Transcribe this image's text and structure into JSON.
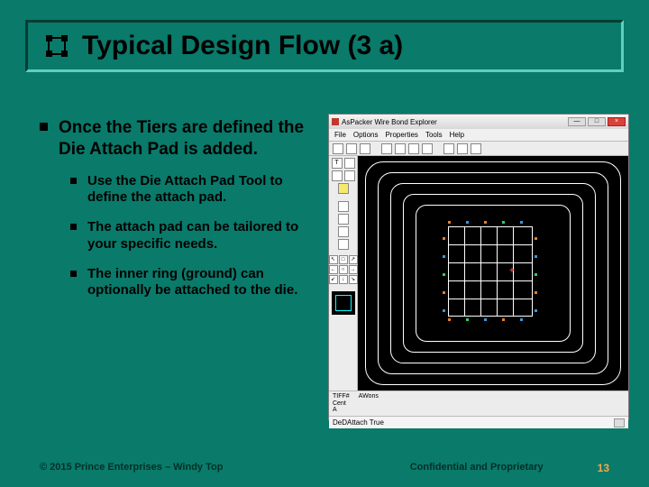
{
  "title": "Typical Design Flow (3 a)",
  "main_bullet": "Once the Tiers are defined the Die Attach Pad is added.",
  "sub_bullets": [
    "Use the Die Attach Pad Tool to define the attach pad.",
    "The attach pad can be tailored to your specific needs.",
    "The inner ring (ground) can optionally be attached to the die."
  ],
  "footer": {
    "left": "© 2015 Prince Enterprises – Windy Top",
    "center": "Confidential and Proprietary",
    "page": "13"
  },
  "screenshot": {
    "window_title": "AsPacker Wire Bond Explorer",
    "menu": [
      "File",
      "Options",
      "Properties",
      "Tools",
      "Help"
    ],
    "palette_T": "T",
    "info": {
      "c1a": "TIFF#",
      "c1b": "Cent",
      "c1c": "A",
      "c2a": "AWons"
    },
    "status_text": "DeDAttach True"
  }
}
